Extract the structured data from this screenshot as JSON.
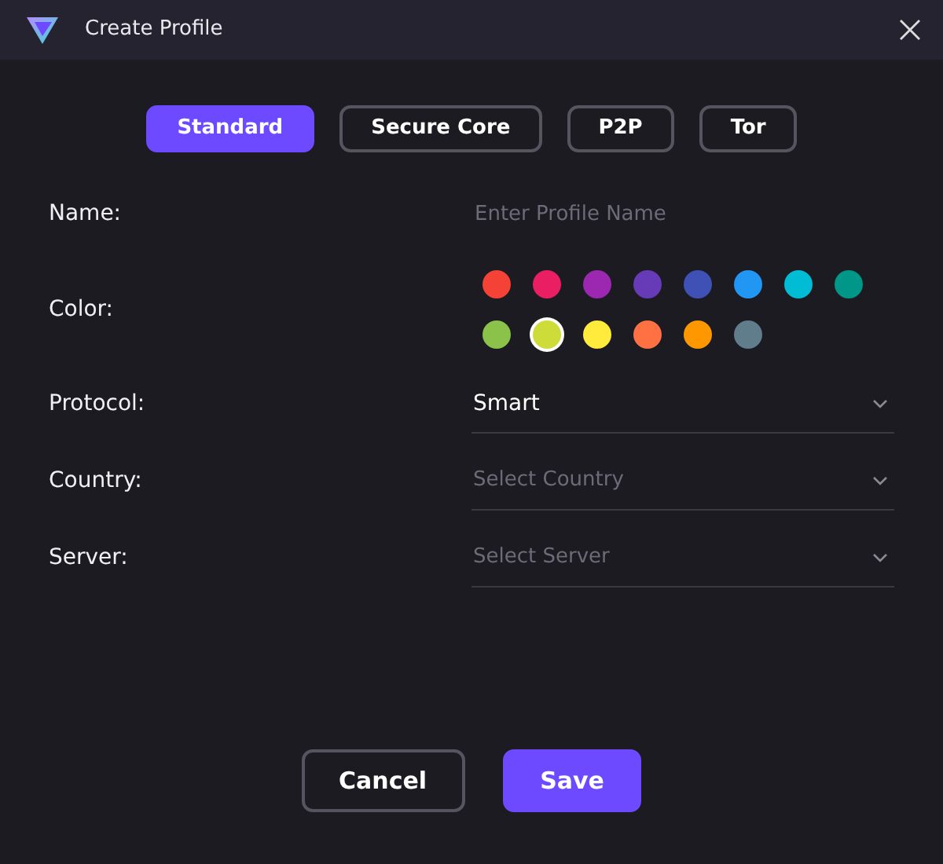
{
  "window": {
    "title": "Create Profile"
  },
  "tabs": [
    {
      "label": "Standard",
      "selected": true
    },
    {
      "label": "Secure Core",
      "selected": false
    },
    {
      "label": "P2P",
      "selected": false
    },
    {
      "label": "Tor",
      "selected": false
    }
  ],
  "fields": [
    {
      "kind": "text",
      "label": "Name:",
      "placeholder": "Enter Profile Name"
    },
    {
      "kind": "color",
      "label": "Color:",
      "colors": [
        {
          "color": "#f44336",
          "selected": false
        },
        {
          "color": "#e91e63",
          "selected": false
        },
        {
          "color": "#9c27b0",
          "selected": false
        },
        {
          "color": "#673ab7",
          "selected": false
        },
        {
          "color": "#3f51b5",
          "selected": false
        },
        {
          "color": "#2196f3",
          "selected": false
        },
        {
          "color": "#00bcd4",
          "selected": false
        },
        {
          "color": "#009688",
          "selected": false
        },
        {
          "color": "#8bc34a",
          "selected": false
        },
        {
          "color": "#cddc39",
          "selected": true
        },
        {
          "color": "#ffeb3b",
          "selected": false
        },
        {
          "color": "#ff7043",
          "selected": false
        },
        {
          "color": "#ff9800",
          "selected": false
        },
        {
          "color": "#607d8b",
          "selected": false
        }
      ]
    },
    {
      "kind": "select",
      "label": "Protocol:",
      "value": "Smart"
    },
    {
      "kind": "select",
      "label": "Country:",
      "placeholder": "Select Country"
    },
    {
      "kind": "select",
      "label": "Server:",
      "placeholder": "Select Server"
    }
  ],
  "buttons": [
    {
      "kind": "secondary",
      "label": "Cancel"
    },
    {
      "kind": "primary",
      "label": "Save"
    }
  ]
}
